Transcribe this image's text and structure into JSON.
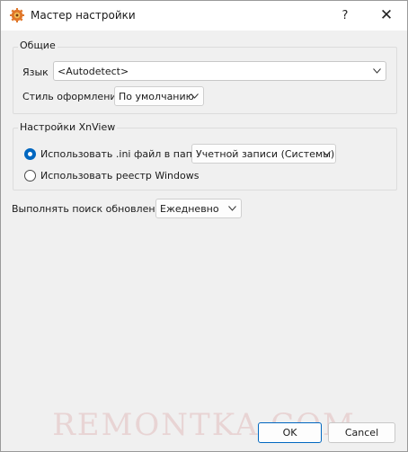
{
  "window": {
    "title": "Мастер настройки",
    "help_label": "?",
    "close_label": "✕"
  },
  "general": {
    "group_label": "Общие",
    "language_label": "Язык",
    "language_value": "<Autodetect>",
    "style_label": "Стиль оформления",
    "style_value": "По умолчанию"
  },
  "xnview_settings": {
    "group_label": "Настройки XnView",
    "option_ini_label": "Использовать .ini файл в папке",
    "option_ini_selected": true,
    "ini_folder_value": "Учетной записи (Системы)",
    "option_registry_label": "Использовать реестр Windows",
    "option_registry_selected": false
  },
  "updates": {
    "label": "Выполнять поиск обновлений",
    "value": "Ежедневно"
  },
  "footer": {
    "watermark": "REMONTKA.COM",
    "ok_label": "OK",
    "cancel_label": "Cancel"
  },
  "colors": {
    "accent": "#0067c0",
    "titlebar": "#ffffff",
    "dialog_bg": "#f0f0f0"
  },
  "icons": {
    "app": "gear-icon",
    "dropdown": "chevron-down-icon"
  }
}
